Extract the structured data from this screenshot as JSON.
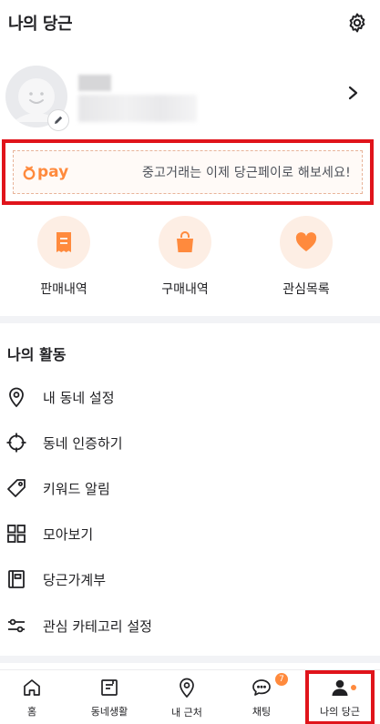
{
  "header": {
    "title": "나의 당근",
    "settings_icon": "gear-icon"
  },
  "profile": {
    "avatar_icon": "smiley-avatar-icon",
    "edit_icon": "pencil-icon",
    "chevron_icon": "chevron-right-icon"
  },
  "pay_banner": {
    "logo_text": "pay",
    "message": "중고거래는 이제 당근페이로 해보세요!",
    "accent": "#ff8a3d",
    "highlight": "#e0141b"
  },
  "quick_menu": [
    {
      "label": "판매내역",
      "icon": "receipt-icon"
    },
    {
      "label": "구매내역",
      "icon": "shopping-bag-icon"
    },
    {
      "label": "관심목록",
      "icon": "heart-icon"
    }
  ],
  "activity": {
    "title": "나의 활동",
    "items": [
      {
        "label": "내 동네 설정",
        "icon": "location-pin-icon"
      },
      {
        "label": "동네 인증하기",
        "icon": "crosshair-icon"
      },
      {
        "label": "키워드 알림",
        "icon": "tag-icon"
      },
      {
        "label": "모아보기",
        "icon": "grid-icon"
      },
      {
        "label": "당근가계부",
        "icon": "ledger-book-icon"
      },
      {
        "label": "관심 카테고리 설정",
        "icon": "sliders-icon"
      }
    ]
  },
  "bottom_nav": [
    {
      "label": "홈",
      "icon": "home-icon"
    },
    {
      "label": "동네생활",
      "icon": "neighborhood-board-icon"
    },
    {
      "label": "내 근처",
      "icon": "location-pin-icon"
    },
    {
      "label": "채팅",
      "icon": "chat-bubble-icon",
      "badge": "7"
    },
    {
      "label": "나의 당근",
      "icon": "person-icon",
      "active": true
    }
  ]
}
